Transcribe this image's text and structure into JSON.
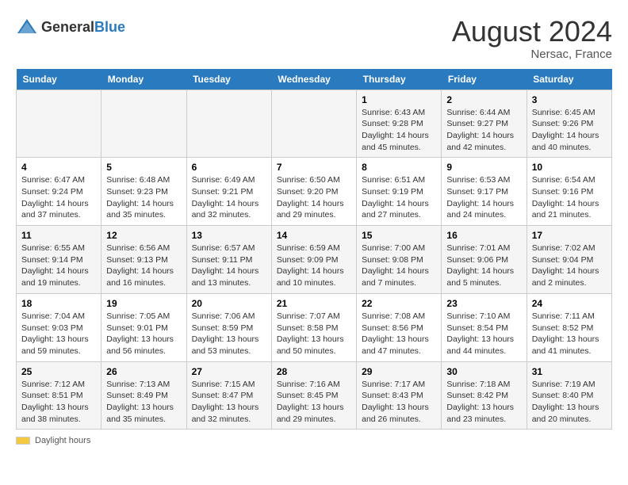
{
  "header": {
    "logo_general": "General",
    "logo_blue": "Blue",
    "month_year": "August 2024",
    "location": "Nersac, France"
  },
  "weekdays": [
    "Sunday",
    "Monday",
    "Tuesday",
    "Wednesday",
    "Thursday",
    "Friday",
    "Saturday"
  ],
  "weeks": [
    [
      {
        "day": "",
        "info": ""
      },
      {
        "day": "",
        "info": ""
      },
      {
        "day": "",
        "info": ""
      },
      {
        "day": "",
        "info": ""
      },
      {
        "day": "1",
        "info": "Sunrise: 6:43 AM\nSunset: 9:28 PM\nDaylight: 14 hours and 45 minutes."
      },
      {
        "day": "2",
        "info": "Sunrise: 6:44 AM\nSunset: 9:27 PM\nDaylight: 14 hours and 42 minutes."
      },
      {
        "day": "3",
        "info": "Sunrise: 6:45 AM\nSunset: 9:26 PM\nDaylight: 14 hours and 40 minutes."
      }
    ],
    [
      {
        "day": "4",
        "info": "Sunrise: 6:47 AM\nSunset: 9:24 PM\nDaylight: 14 hours and 37 minutes."
      },
      {
        "day": "5",
        "info": "Sunrise: 6:48 AM\nSunset: 9:23 PM\nDaylight: 14 hours and 35 minutes."
      },
      {
        "day": "6",
        "info": "Sunrise: 6:49 AM\nSunset: 9:21 PM\nDaylight: 14 hours and 32 minutes."
      },
      {
        "day": "7",
        "info": "Sunrise: 6:50 AM\nSunset: 9:20 PM\nDaylight: 14 hours and 29 minutes."
      },
      {
        "day": "8",
        "info": "Sunrise: 6:51 AM\nSunset: 9:19 PM\nDaylight: 14 hours and 27 minutes."
      },
      {
        "day": "9",
        "info": "Sunrise: 6:53 AM\nSunset: 9:17 PM\nDaylight: 14 hours and 24 minutes."
      },
      {
        "day": "10",
        "info": "Sunrise: 6:54 AM\nSunset: 9:16 PM\nDaylight: 14 hours and 21 minutes."
      }
    ],
    [
      {
        "day": "11",
        "info": "Sunrise: 6:55 AM\nSunset: 9:14 PM\nDaylight: 14 hours and 19 minutes."
      },
      {
        "day": "12",
        "info": "Sunrise: 6:56 AM\nSunset: 9:13 PM\nDaylight: 14 hours and 16 minutes."
      },
      {
        "day": "13",
        "info": "Sunrise: 6:57 AM\nSunset: 9:11 PM\nDaylight: 14 hours and 13 minutes."
      },
      {
        "day": "14",
        "info": "Sunrise: 6:59 AM\nSunset: 9:09 PM\nDaylight: 14 hours and 10 minutes."
      },
      {
        "day": "15",
        "info": "Sunrise: 7:00 AM\nSunset: 9:08 PM\nDaylight: 14 hours and 7 minutes."
      },
      {
        "day": "16",
        "info": "Sunrise: 7:01 AM\nSunset: 9:06 PM\nDaylight: 14 hours and 5 minutes."
      },
      {
        "day": "17",
        "info": "Sunrise: 7:02 AM\nSunset: 9:04 PM\nDaylight: 14 hours and 2 minutes."
      }
    ],
    [
      {
        "day": "18",
        "info": "Sunrise: 7:04 AM\nSunset: 9:03 PM\nDaylight: 13 hours and 59 minutes."
      },
      {
        "day": "19",
        "info": "Sunrise: 7:05 AM\nSunset: 9:01 PM\nDaylight: 13 hours and 56 minutes."
      },
      {
        "day": "20",
        "info": "Sunrise: 7:06 AM\nSunset: 8:59 PM\nDaylight: 13 hours and 53 minutes."
      },
      {
        "day": "21",
        "info": "Sunrise: 7:07 AM\nSunset: 8:58 PM\nDaylight: 13 hours and 50 minutes."
      },
      {
        "day": "22",
        "info": "Sunrise: 7:08 AM\nSunset: 8:56 PM\nDaylight: 13 hours and 47 minutes."
      },
      {
        "day": "23",
        "info": "Sunrise: 7:10 AM\nSunset: 8:54 PM\nDaylight: 13 hours and 44 minutes."
      },
      {
        "day": "24",
        "info": "Sunrise: 7:11 AM\nSunset: 8:52 PM\nDaylight: 13 hours and 41 minutes."
      }
    ],
    [
      {
        "day": "25",
        "info": "Sunrise: 7:12 AM\nSunset: 8:51 PM\nDaylight: 13 hours and 38 minutes."
      },
      {
        "day": "26",
        "info": "Sunrise: 7:13 AM\nSunset: 8:49 PM\nDaylight: 13 hours and 35 minutes."
      },
      {
        "day": "27",
        "info": "Sunrise: 7:15 AM\nSunset: 8:47 PM\nDaylight: 13 hours and 32 minutes."
      },
      {
        "day": "28",
        "info": "Sunrise: 7:16 AM\nSunset: 8:45 PM\nDaylight: 13 hours and 29 minutes."
      },
      {
        "day": "29",
        "info": "Sunrise: 7:17 AM\nSunset: 8:43 PM\nDaylight: 13 hours and 26 minutes."
      },
      {
        "day": "30",
        "info": "Sunrise: 7:18 AM\nSunset: 8:42 PM\nDaylight: 13 hours and 23 minutes."
      },
      {
        "day": "31",
        "info": "Sunrise: 7:19 AM\nSunset: 8:40 PM\nDaylight: 13 hours and 20 minutes."
      }
    ]
  ],
  "footer": {
    "label": "Daylight hours"
  }
}
